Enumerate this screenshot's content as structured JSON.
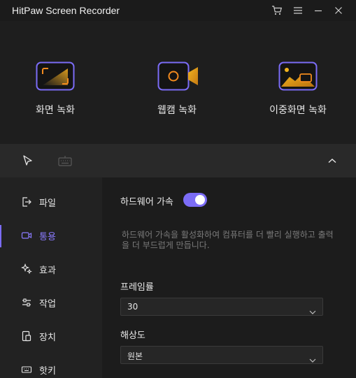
{
  "window": {
    "title": "HitPaw Screen Recorder",
    "controls": [
      "cart-icon",
      "menu-icon",
      "minimize-icon",
      "close-icon"
    ]
  },
  "modes": [
    {
      "label": "화면 녹화",
      "icon": "screen-record-icon"
    },
    {
      "label": "웹캠 녹화",
      "icon": "webcam-record-icon"
    },
    {
      "label": "이중화면 녹화",
      "icon": "dual-screen-record-icon"
    }
  ],
  "toolbar": {
    "tools": [
      "cursor-icon",
      "keyboard-icon"
    ],
    "collapse": "chevron-up-icon"
  },
  "sidebar": {
    "items": [
      {
        "label": "파일",
        "icon": "file-export-icon",
        "active": false
      },
      {
        "label": "통용",
        "icon": "camera-icon",
        "active": true
      },
      {
        "label": "효과",
        "icon": "sparkle-icon",
        "active": false
      },
      {
        "label": "작업",
        "icon": "sliders-icon",
        "active": false
      },
      {
        "label": "장치",
        "icon": "device-icon",
        "active": false
      },
      {
        "label": "핫키",
        "icon": "keyboard-icon",
        "active": false
      }
    ]
  },
  "settings": {
    "hardware_accel": {
      "label": "하드웨어 가속",
      "enabled": true,
      "description": "하드웨어 가속을 활성화하여 컴퓨터를 더 빨리 실행하고 출력을 더 부드럽게 만듭니다."
    },
    "frame_rate": {
      "label": "프레임률",
      "value": "30"
    },
    "resolution": {
      "label": "해상도",
      "value": "원본"
    }
  },
  "colors": {
    "accent": "#7b6cf6",
    "orange": "#f28a1e",
    "background": "#1c1c1c"
  }
}
